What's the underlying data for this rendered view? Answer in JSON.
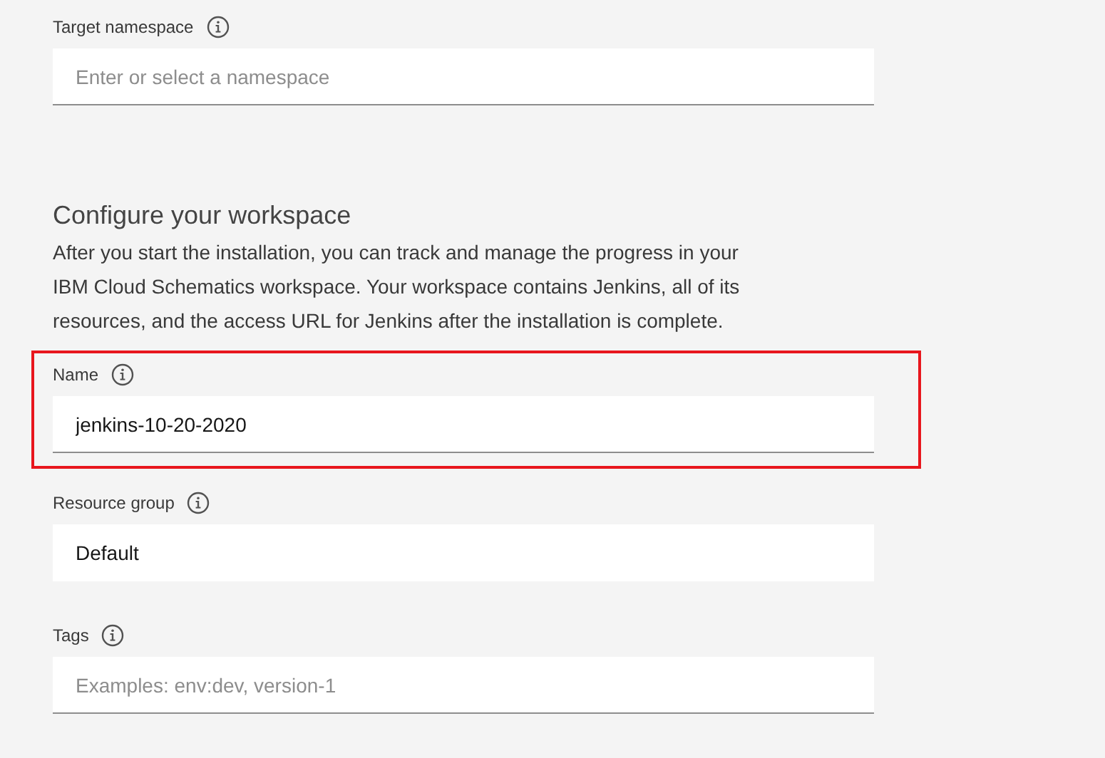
{
  "namespace_field": {
    "label": "Target namespace",
    "placeholder": "Enter or select a namespace",
    "kind": "input",
    "highlighted": false
  },
  "workspace": {
    "title": "Configure your workspace",
    "description": "After you start the installation, you can track and manage the progress in your IBM Cloud Schematics workspace. Your workspace contains Jenkins, all of its resources, and the access URL for Jenkins after the installation is complete.",
    "fields": [
      {
        "label": "Name",
        "value": "jenkins-10-20-2020",
        "kind": "input",
        "highlighted": true
      },
      {
        "label": "Resource group",
        "value": "Default",
        "kind": "select",
        "highlighted": false
      },
      {
        "label": "Tags",
        "placeholder": "Examples: env:dev, version-1",
        "kind": "input",
        "highlighted": false
      }
    ]
  }
}
